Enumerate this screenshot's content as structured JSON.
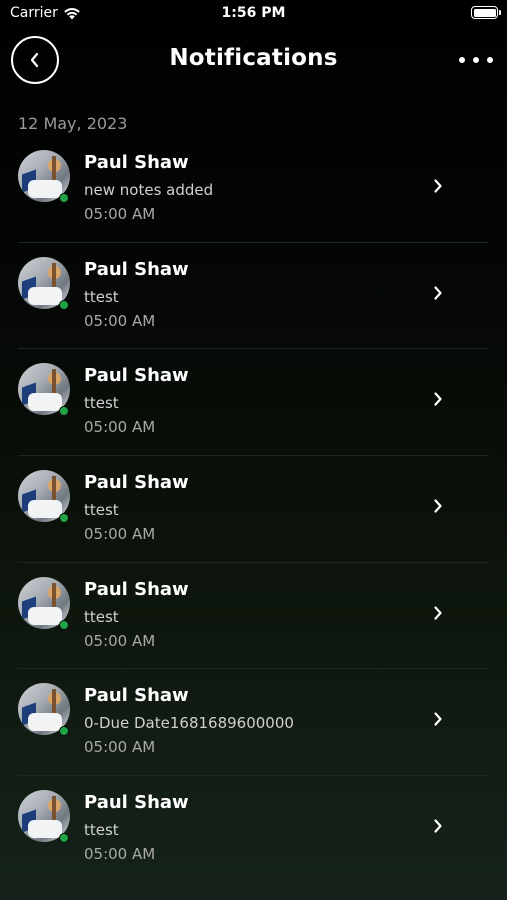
{
  "status_bar": {
    "carrier": "Carrier",
    "time": "1:56 PM"
  },
  "header": {
    "title": "Notifications"
  },
  "date_group": "12 May, 2023",
  "notifications": [
    {
      "name": "Paul Shaw",
      "message": "new notes added",
      "time": "05:00 AM",
      "online": true
    },
    {
      "name": "Paul Shaw",
      "message": "ttest",
      "time": "05:00 AM",
      "online": true
    },
    {
      "name": "Paul Shaw",
      "message": "ttest",
      "time": "05:00 AM",
      "online": true
    },
    {
      "name": "Paul Shaw",
      "message": "ttest",
      "time": "05:00 AM",
      "online": true
    },
    {
      "name": "Paul Shaw",
      "message": "ttest",
      "time": "05:00 AM",
      "online": true
    },
    {
      "name": "Paul Shaw",
      "message": "0-Due Date1681689600000",
      "time": "05:00 AM",
      "online": true
    },
    {
      "name": "Paul Shaw",
      "message": "ttest",
      "time": "05:00 AM",
      "online": true
    }
  ],
  "icons": {
    "back": "chevron-left-icon",
    "more": "more-horizontal-icon",
    "row": "chevron-right-icon",
    "wifi": "wifi-icon",
    "battery": "battery-icon"
  },
  "colors": {
    "online": "#1fa347",
    "background_top": "#000000",
    "background_bottom": "#16231a"
  }
}
